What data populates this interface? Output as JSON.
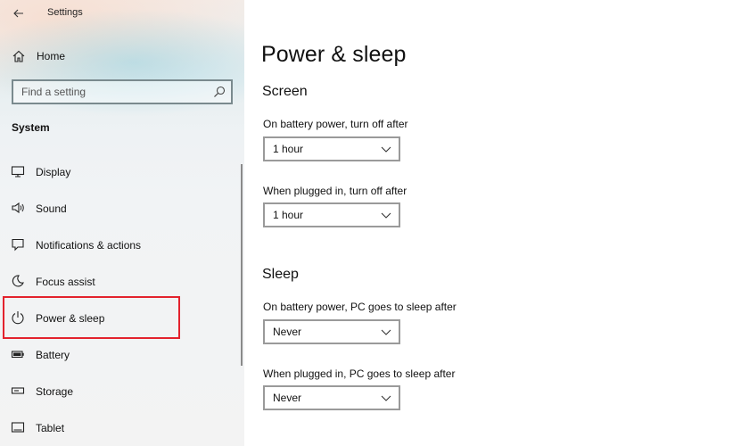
{
  "window": {
    "title": "Settings"
  },
  "sidebar": {
    "home_label": "Home",
    "search_placeholder": "Find a setting",
    "section_title": "System",
    "items": [
      {
        "label": "Display",
        "icon": "monitor-icon"
      },
      {
        "label": "Sound",
        "icon": "speaker-icon"
      },
      {
        "label": "Notifications & actions",
        "icon": "notification-icon"
      },
      {
        "label": "Focus assist",
        "icon": "moon-icon"
      },
      {
        "label": "Power & sleep",
        "icon": "power-icon",
        "selected": true
      },
      {
        "label": "Battery",
        "icon": "battery-icon"
      },
      {
        "label": "Storage",
        "icon": "storage-icon"
      },
      {
        "label": "Tablet",
        "icon": "tablet-icon"
      }
    ]
  },
  "main": {
    "page_title": "Power & sleep",
    "screen": {
      "title": "Screen",
      "battery_label": "On battery power, turn off after",
      "battery_value": "1 hour",
      "plugged_label": "When plugged in, turn off after",
      "plugged_value": "1 hour"
    },
    "sleep": {
      "title": "Sleep",
      "battery_label": "On battery power, PC goes to sleep after",
      "battery_value": "Never",
      "plugged_label": "When plugged in, PC goes to sleep after",
      "plugged_value": "Never"
    }
  },
  "colors": {
    "highlight": "#e3222d",
    "sidebar_bg": "#f1f3f5"
  }
}
